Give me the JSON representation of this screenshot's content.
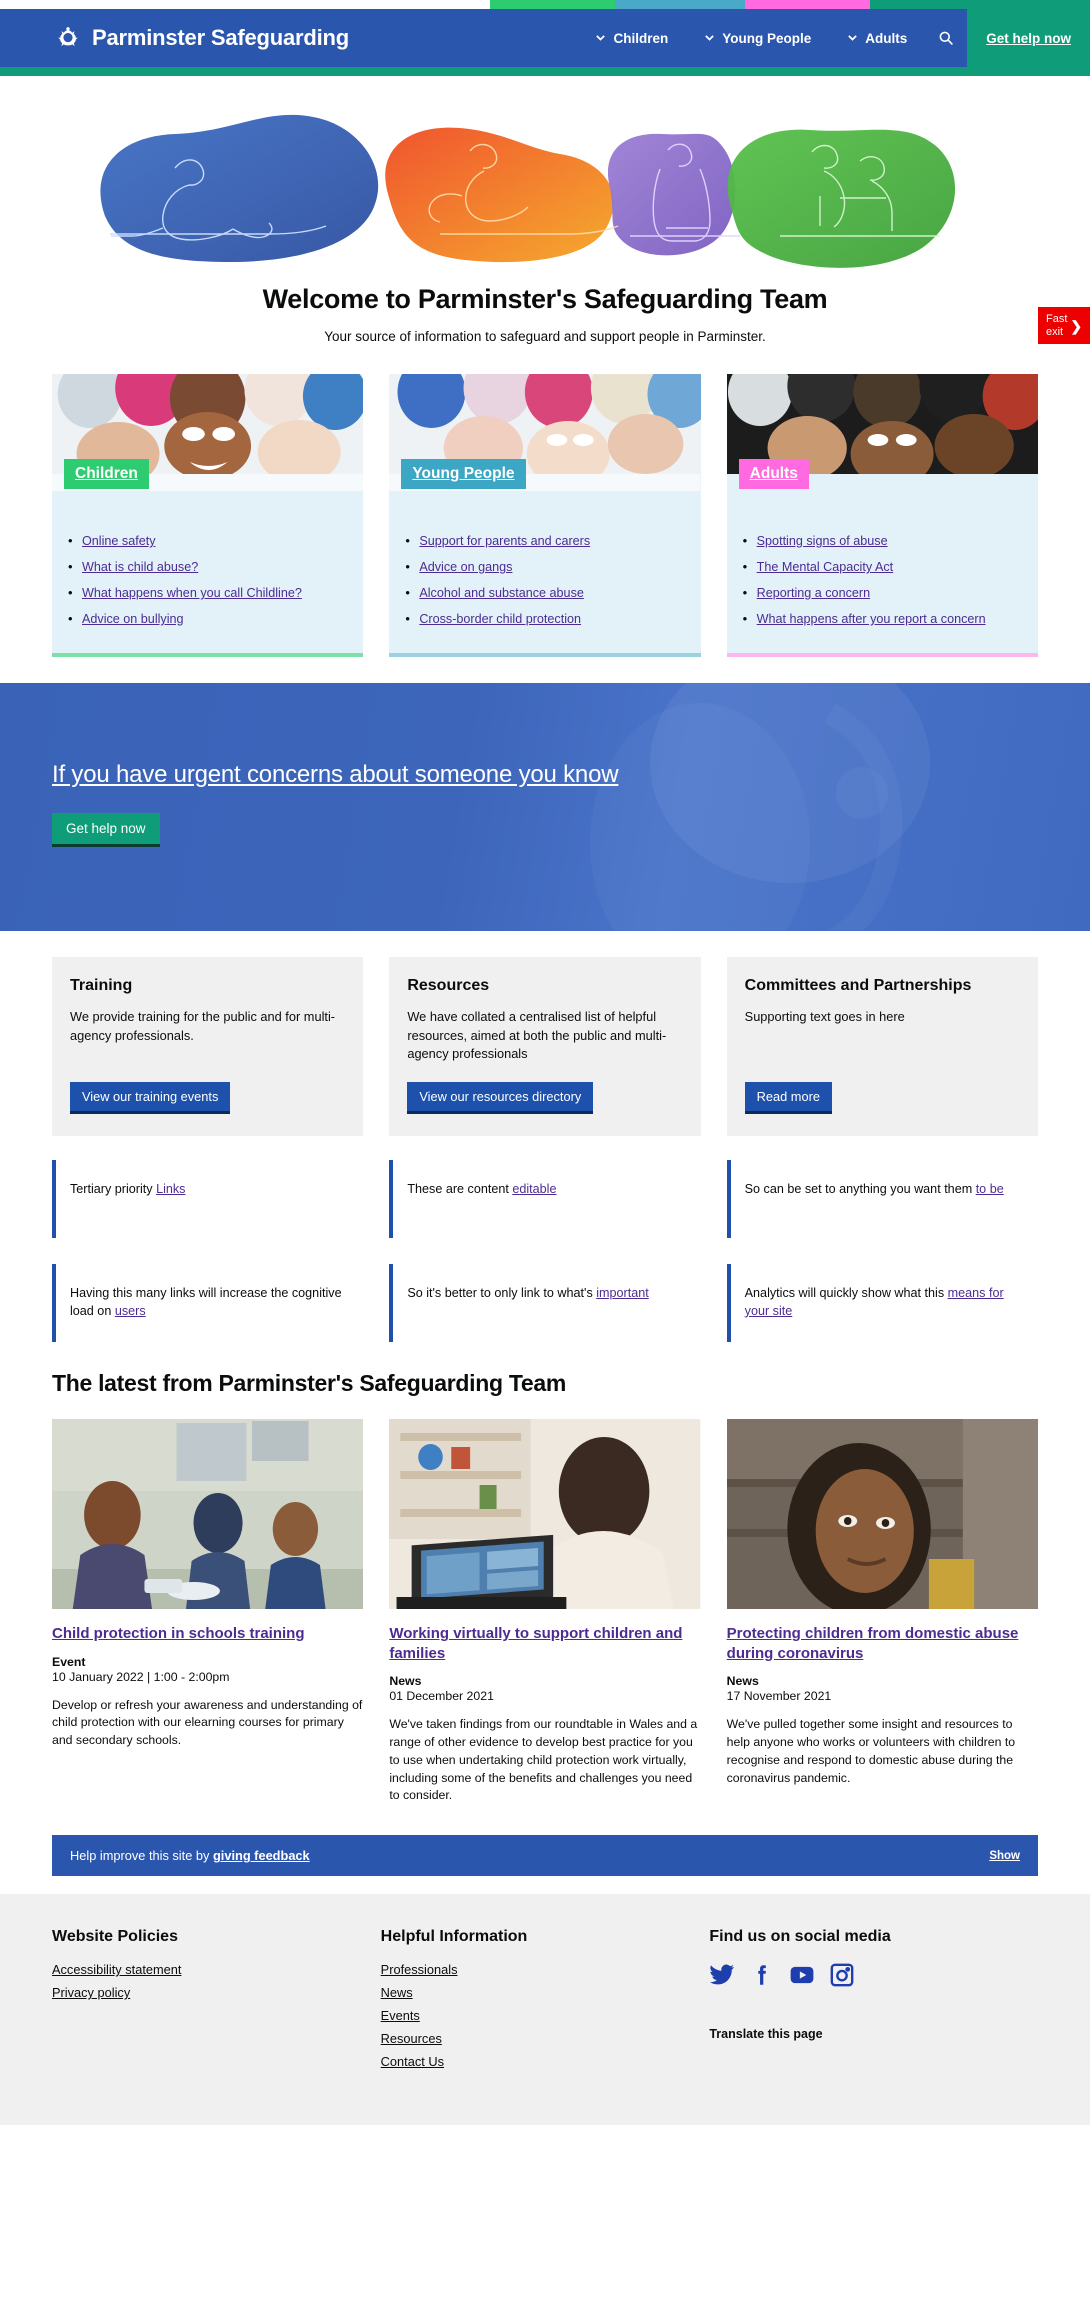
{
  "header": {
    "brand_title": "Parminster Safeguarding",
    "brand_logo_icon": "safeguarding-crest-icon",
    "nav": [
      {
        "label": "Children",
        "icon": "chevron-down-icon"
      },
      {
        "label": "Young People",
        "icon": "chevron-down-icon"
      },
      {
        "label": "Adults",
        "icon": "chevron-down-icon"
      }
    ],
    "search_icon": "search-icon",
    "get_help_label": "Get help now",
    "colors": {
      "nav_blue": "#2b56ad",
      "green": "#0f9d79",
      "strip_green": "#2ecc71",
      "strip_blue": "#4aa9c7",
      "strip_pink": "#ff6ae0"
    }
  },
  "fast_exit": {
    "line1": "Fast",
    "line2": "exit",
    "arrow": "❯",
    "color": "#ec0000"
  },
  "welcome": {
    "title": "Welcome to Parminster's Safeguarding Team",
    "subtitle": "Your source of information to safeguard and support people in Parminster."
  },
  "audience_cards": [
    {
      "tag": "Children",
      "tag_color": "#2ecc71",
      "underline_color": "#7ee0a6",
      "image_alt": "children-circle-photo",
      "links": [
        "Online safety",
        "What is child abuse?",
        "What happens when you call Childline?",
        "Advice on bullying"
      ]
    },
    {
      "tag": "Young People",
      "tag_color": "#3ba7c4",
      "underline_color": "#9ad2e2",
      "image_alt": "young-people-circle-photo",
      "links": [
        "Support for parents and carers",
        "Advice on gangs",
        "Alcohol and substance abuse",
        "Cross-border child protection"
      ]
    },
    {
      "tag": "Adults",
      "tag_color": "#ff6ae0",
      "underline_color": "#ffb6ef",
      "image_alt": "adults-circle-photo",
      "links": [
        "Spotting signs of abuse",
        "The Mental Capacity Act",
        "Reporting a concern",
        "What happens after you report a concern"
      ]
    }
  ],
  "urgent": {
    "heading": "If you have urgent concerns about someone you know",
    "button_label": "Get help now",
    "button_color": "#0f9d79"
  },
  "promos": [
    {
      "title": "Training",
      "body": "We provide training for the public and for multi-agency professionals.",
      "button": "View our training events"
    },
    {
      "title": "Resources",
      "body": "We have collated a centralised list of helpful resources, aimed at both the public and multi-agency professionals",
      "button": "View our resources directory"
    },
    {
      "title": "Committees and Partnerships",
      "body": "Supporting text goes in here",
      "button": "Read more"
    }
  ],
  "tertiary": [
    {
      "text_before": "Tertiary priority ",
      "link": "Links",
      "text_after": ""
    },
    {
      "text_before": "These are content ",
      "link": "editable",
      "text_after": ""
    },
    {
      "text_before": "So can be set to anything you want them ",
      "link": "to be",
      "text_after": ""
    },
    {
      "text_before": "Having this many links will increase the cognitive load on ",
      "link": "users",
      "text_after": ""
    },
    {
      "text_before": "So it's better to only link to what's ",
      "link": "important",
      "text_after": ""
    },
    {
      "text_before": "Analytics will quickly show what this ",
      "link": "means for your site",
      "text_after": ""
    }
  ],
  "latest": {
    "heading": "The latest from Parminster's Safeguarding Team",
    "items": [
      {
        "title": "Child protection in schools training",
        "type": "Event",
        "date": "10 January 2022 | 1:00 - 2:00pm",
        "summary": "Develop or refresh your awareness and understanding of child protection with our elearning courses for primary and secondary schools.",
        "image_alt": "classroom-teacher-photo"
      },
      {
        "title": "Working virtually to support children and families",
        "type": "News",
        "date": "01 December 2021",
        "summary": "We've taken findings from our roundtable in Wales and a range of other evidence to develop best practice for you to use when undertaking child protection work virtually, including some of the benefits and challenges you need to consider.",
        "image_alt": "video-call-laptop-photo"
      },
      {
        "title": "Protecting children from domestic abuse during coronavirus",
        "type": "News",
        "date": "17 November 2021",
        "summary": "We've pulled together some insight and resources to help anyone who works or volunteers with children to recognise and respond to domestic abuse during the coronavirus pandemic.",
        "image_alt": "child-in-fur-hood-photo"
      }
    ]
  },
  "feedback": {
    "text_before": "Help improve this site by ",
    "link": "giving feedback",
    "show_label": "Show"
  },
  "footer": {
    "columns": [
      {
        "heading": "Website Policies",
        "links": [
          "Accessibility statement",
          "Privacy policy"
        ]
      },
      {
        "heading": "Helpful Information",
        "links": [
          "Professionals",
          "News",
          "Events",
          "Resources",
          "Contact Us"
        ]
      }
    ],
    "social_heading": "Find us on social media",
    "social_icons": [
      "twitter-icon",
      "facebook-icon",
      "youtube-icon",
      "instagram-icon"
    ],
    "translate_label": "Translate this page",
    "social_color": "#1d3fae"
  }
}
